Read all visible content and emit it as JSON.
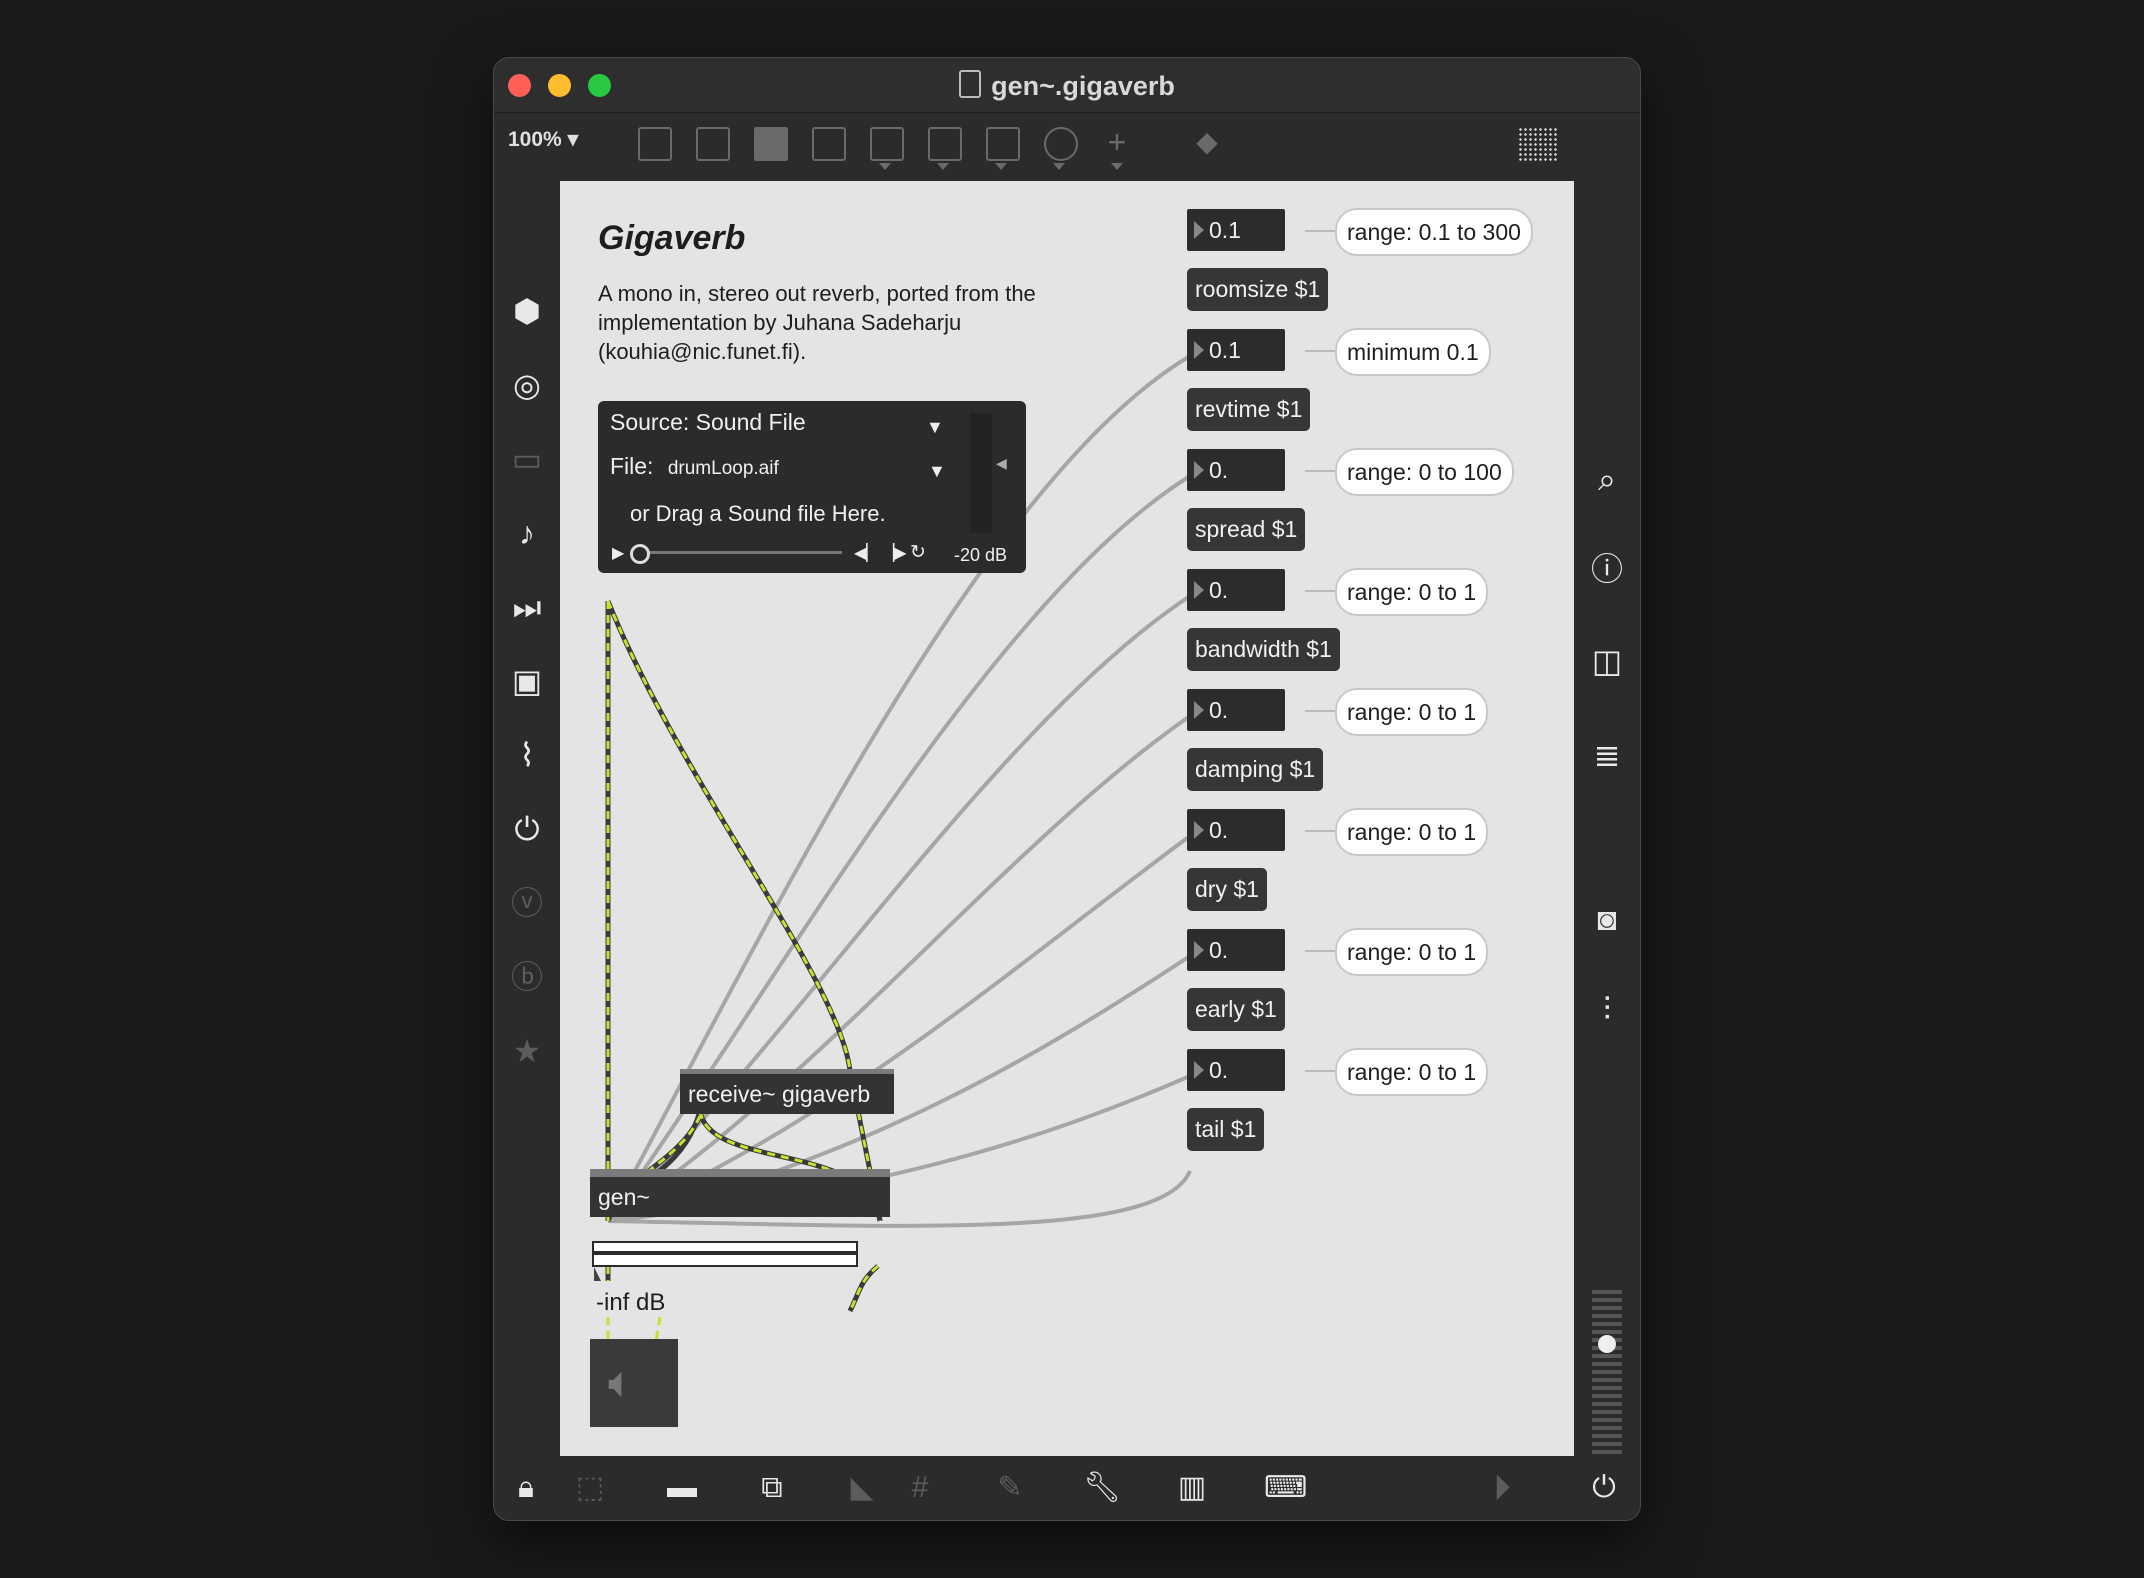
{
  "window": {
    "title": "gen~.gigaverb",
    "zoom": "100%"
  },
  "patcher": {
    "heading": "Gigaverb",
    "description": "A mono in, stereo out reverb, ported from the implementation by Juhana Sadeharju (kouhia@nic.funet.fi).",
    "player": {
      "source": "Source: Sound File",
      "file_label": "File:",
      "file_value": "drumLoop.aif",
      "drag_hint": "or Drag a Sound file Here.",
      "gain": "-20 dB"
    },
    "params": [
      {
        "number": "0.1",
        "message": "roomsize $1",
        "comment": "range: 0.1 to 300"
      },
      {
        "number": "0.1",
        "message": "revtime $1",
        "comment": "minimum 0.1"
      },
      {
        "number": "0.",
        "message": "spread $1",
        "comment": "range: 0 to 100"
      },
      {
        "number": "0.",
        "message": "bandwidth $1",
        "comment": "range: 0 to 1"
      },
      {
        "number": "0.",
        "message": "damping $1",
        "comment": "range: 0 to 1"
      },
      {
        "number": "0.",
        "message": "dry $1",
        "comment": "range: 0 to 1"
      },
      {
        "number": "0.",
        "message": "early $1",
        "comment": "range: 0 to 1"
      },
      {
        "number": "0.",
        "message": "tail $1",
        "comment": "range: 0 to 1"
      }
    ],
    "receive": "receive~ gigaverb",
    "gen": "gen~",
    "level": "-inf dB"
  },
  "icons": {
    "left_sidebar": [
      "cube-icon",
      "target-icon",
      "keyboard-icon",
      "music-note-icon",
      "step-icon",
      "image-icon",
      "paperclip-icon",
      "plugin-icon",
      "v-icon",
      "b-icon",
      "star-icon"
    ],
    "right_sidebar": [
      "search-icon",
      "info-icon",
      "columns-icon",
      "list-icon",
      "camera-icon",
      "sliders-icon"
    ],
    "bottom": [
      "lock-icon",
      "cursor-icon",
      "presentation-icon",
      "windows-icon",
      "mute-icon",
      "grid-icon",
      "add-object-icon",
      "wrench-icon",
      "piano-icon",
      "keyboard-icon",
      "play-icon",
      "power-icon"
    ]
  },
  "colors": {
    "canvas": "#e4e4e4",
    "object": "#333333",
    "signal_wire": "#c8e02e"
  }
}
